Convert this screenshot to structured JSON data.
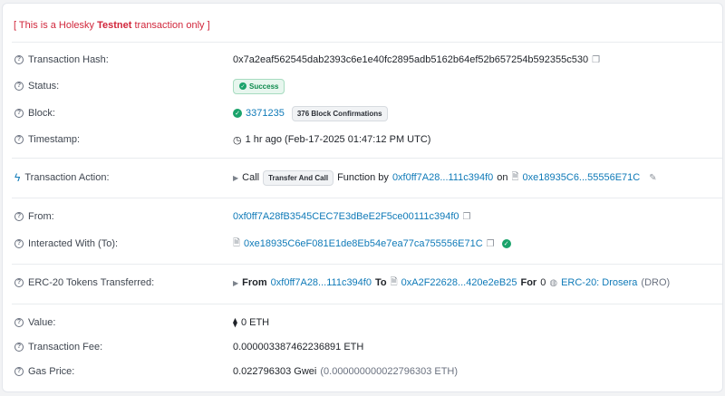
{
  "notice": {
    "open": "[ This is a Holesky ",
    "bold": "Testnet",
    "close": " transaction only ]"
  },
  "rows": {
    "hash": {
      "label": "Transaction Hash:",
      "value": "0x7a2eaf562545dab2393c6e1e40fc2895adb5162b64ef52b657254b592355c530"
    },
    "status": {
      "label": "Status:",
      "value": "Success"
    },
    "block": {
      "label": "Block:",
      "number": "3371235",
      "confirmations": "376 Block Confirmations"
    },
    "timestamp": {
      "label": "Timestamp:",
      "value": "1 hr ago (Feb-17-2025 01:47:12 PM UTC)"
    },
    "action": {
      "label": "Transaction Action:",
      "call": "Call",
      "method": "Transfer And Call",
      "function_by": "Function by",
      "from": "0xf0ff7A28...111c394f0",
      "on": "on",
      "contract": "0xe18935C6...55556E71C"
    },
    "from": {
      "label": "From:",
      "value": "0xf0ff7A28fB3545CEC7E3dBeE2F5ce00111c394f0"
    },
    "to": {
      "label": "Interacted With (To):",
      "value": "0xe18935C6eF081E1de8Eb54e7ea77ca755556E71C"
    },
    "erc20": {
      "label": "ERC-20 Tokens Transferred:",
      "from_word": "From",
      "from": "0xf0ff7A28...111c394f0",
      "to_word": "To",
      "to": "0xA2F22628...420e2eB25",
      "for_word": "For",
      "amount": "0",
      "token": "ERC-20: Drosera",
      "symbol": "(DRO)"
    },
    "value": {
      "label": "Value:",
      "amount": "0 ETH"
    },
    "fee": {
      "label": "Transaction Fee:",
      "value": "0.000003387462236891 ETH"
    },
    "gas": {
      "label": "Gas Price:",
      "gwei": "0.022796303 Gwei",
      "eth": "(0.000000000022796303 ETH)"
    }
  },
  "colors": {
    "link": "#0f7ab8",
    "success": "#0f8a4e",
    "notice": "#d1263b"
  },
  "icons": [
    "question-icon",
    "copy-icon",
    "check-circle-icon",
    "clock-icon",
    "lightning-icon",
    "caret-right-icon",
    "file-contract-icon",
    "pencil-icon",
    "eth-icon",
    "token-icon"
  ]
}
